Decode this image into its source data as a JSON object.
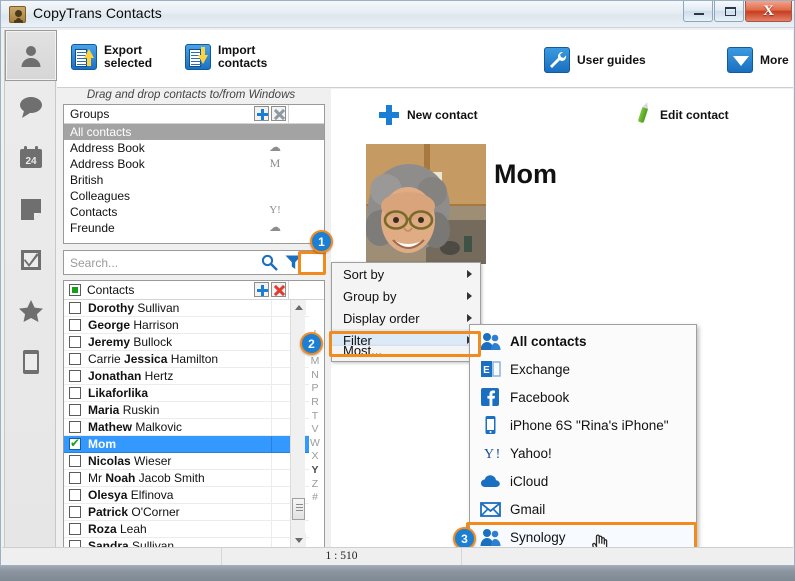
{
  "window": {
    "title": "CopyTrans Contacts",
    "app_icon": "person-badge-icon",
    "minimize_label": "",
    "maximize_label": "",
    "close_label": "X"
  },
  "modules": [
    {
      "name": "contacts",
      "icon": "person-icon",
      "active": true
    },
    {
      "name": "messages",
      "icon": "chat-bubble-icon",
      "active": false
    },
    {
      "name": "calendar",
      "icon": "calendar-24-icon",
      "active": false
    },
    {
      "name": "notes",
      "icon": "note-icon",
      "active": false
    },
    {
      "name": "tasks",
      "icon": "checkbox-task-icon",
      "active": false
    },
    {
      "name": "favorites",
      "icon": "star-icon",
      "active": false
    },
    {
      "name": "device",
      "icon": "phone-icon",
      "active": false
    }
  ],
  "toolbar": {
    "export_label": "Export\nselected",
    "export_line1": "Export",
    "export_line2": "selected",
    "import_line1": "Import",
    "import_line2": "contacts",
    "user_guides_label": "User guides",
    "more_label": "More"
  },
  "hint": "Drag and drop contacts to/from Windows",
  "groups_panel": {
    "header": "Groups",
    "add_button": "+",
    "remove_button": "x",
    "rows": [
      {
        "label": "All contacts",
        "service": "",
        "selected": true
      },
      {
        "label": "Address Book",
        "service": "☁",
        "selected": false
      },
      {
        "label": "Address Book",
        "service": "M",
        "selected": false
      },
      {
        "label": "British",
        "service": "",
        "selected": false
      },
      {
        "label": "Colleagues",
        "service": "",
        "selected": false
      },
      {
        "label": "Contacts",
        "service": "Y!",
        "selected": false
      },
      {
        "label": "Freunde",
        "service": "☁",
        "selected": false
      }
    ]
  },
  "search": {
    "value": "",
    "placeholder": "Search...",
    "magnifier_icon": "search-icon",
    "filter_icon": "funnel-filter-icon"
  },
  "contacts_panel": {
    "header": "Contacts",
    "add_button": "+",
    "remove_button": "x",
    "rows": [
      {
        "first": "Dorothy",
        "rest": " Sullivan",
        "pre": "",
        "selected": false
      },
      {
        "first": "George",
        "rest": " Harrison",
        "pre": "",
        "selected": false
      },
      {
        "first": "Jeremy",
        "rest": " Bullock",
        "pre": "",
        "selected": false
      },
      {
        "first": "Jessica",
        "rest": " Hamilton",
        "pre": "Carrie ",
        "selected": false
      },
      {
        "first": "Jonathan",
        "rest": " Hertz",
        "pre": "",
        "selected": false
      },
      {
        "first": "Likaforlika",
        "rest": "",
        "pre": "",
        "selected": false
      },
      {
        "first": "Maria",
        "rest": " Ruskin",
        "pre": "",
        "selected": false
      },
      {
        "first": "Mathew",
        "rest": " Malkovic",
        "pre": "",
        "selected": false
      },
      {
        "first": "Mom",
        "rest": "",
        "pre": "",
        "selected": true
      },
      {
        "first": "Nicolas",
        "rest": " Wieser",
        "pre": "",
        "selected": false
      },
      {
        "first": "Noah",
        "rest": " Jacob Smith",
        "pre": "Mr ",
        "selected": false
      },
      {
        "first": "Olesya",
        "rest": " Elfinova",
        "pre": "",
        "selected": false
      },
      {
        "first": "Patrick",
        "rest": " O'Corner",
        "pre": "",
        "selected": false
      },
      {
        "first": "Roza",
        "rest": " Leah",
        "pre": "",
        "selected": false
      },
      {
        "first": "Sandra",
        "rest": " Sullivan",
        "pre": "",
        "selected": false
      }
    ],
    "alphabet_index": [
      "I",
      "K",
      "M",
      "N",
      "P",
      "R",
      "T",
      "V",
      "W",
      "X",
      "Y",
      "Z",
      "#"
    ],
    "alphabet_active": "Y"
  },
  "main": {
    "new_contact_label": "New contact",
    "edit_contact_label": "Edit contact",
    "contact_name": "Mom",
    "photo_alt": "contact-photo"
  },
  "context_menu": {
    "items": [
      {
        "label": "Sort by",
        "has_submenu": true,
        "highlighted": false
      },
      {
        "label": "Group by",
        "has_submenu": true,
        "highlighted": false
      },
      {
        "label": "Display order",
        "has_submenu": true,
        "highlighted": false
      },
      {
        "label": "Filter",
        "has_submenu": true,
        "highlighted": true
      }
    ],
    "clipped_item": "Most..."
  },
  "filter_submenu": {
    "items": [
      {
        "label": "All contacts",
        "icon": "people-icon",
        "bold": true,
        "highlighted": false
      },
      {
        "label": "Exchange",
        "icon": "exchange-icon",
        "bold": false,
        "highlighted": false
      },
      {
        "label": "Facebook",
        "icon": "facebook-icon",
        "bold": false,
        "highlighted": false
      },
      {
        "label": "iPhone 6S \"Rina's iPhone\"",
        "icon": "iphone-icon",
        "bold": false,
        "highlighted": false
      },
      {
        "label": "Yahoo!",
        "icon": "yahoo-icon",
        "bold": false,
        "highlighted": false
      },
      {
        "label": "iCloud",
        "icon": "cloud-icon",
        "bold": false,
        "highlighted": false
      },
      {
        "label": "Gmail",
        "icon": "envelope-icon",
        "bold": false,
        "highlighted": false
      },
      {
        "label": "Synology",
        "icon": "people-icon",
        "bold": false,
        "highlighted": true
      }
    ]
  },
  "annotations": {
    "badges": [
      {
        "number": "1",
        "target": "filter-button"
      },
      {
        "number": "2",
        "target": "filter-menu-item"
      },
      {
        "number": "3",
        "target": "synology-menu-item"
      }
    ],
    "highlight_color": "#f28a1e",
    "badge_color": "#1b7fd4"
  },
  "status_bar": {
    "counter": "1 : 510"
  },
  "colors": {
    "selection_blue": "#3399ff",
    "group_selection_gray": "#a3a3a3",
    "accent_orange": "#f28a1e",
    "icon_blue": "#1a7fd4",
    "close_red": "#c63e20"
  }
}
